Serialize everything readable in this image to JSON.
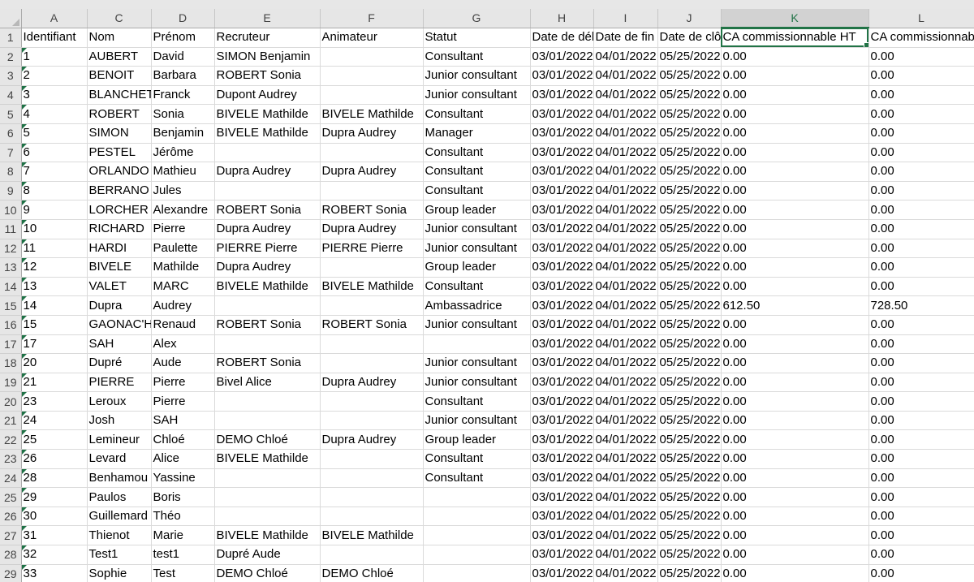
{
  "columns": [
    "A",
    "C",
    "D",
    "E",
    "F",
    "G",
    "H",
    "I",
    "J",
    "K",
    "L"
  ],
  "selected_column": "K",
  "header_row_number": "1",
  "headers": {
    "A": "Identifiant",
    "C": "Nom",
    "D": "Prénom",
    "E": "Recruteur",
    "F": "Animateur",
    "G": "Statut",
    "H": "Date de début",
    "I": "Date de fin",
    "J": "Date de clôture",
    "K": "CA commissionnable HT",
    "L": "CA commissionnable TTC"
  },
  "rows": [
    {
      "row": "2",
      "A": "1",
      "C": "AUBERT",
      "D": "David",
      "E": "SIMON Benjamin",
      "F": "",
      "G": "Consultant",
      "H": "03/01/2022",
      "I": "04/01/2022",
      "J": "05/25/2022",
      "K": "0.00",
      "L": "0.00"
    },
    {
      "row": "3",
      "A": "2",
      "C": "BENOIT",
      "D": "Barbara",
      "E": "ROBERT Sonia",
      "F": "",
      "G": "Junior consultant",
      "H": "03/01/2022",
      "I": "04/01/2022",
      "J": "05/25/2022",
      "K": "0.00",
      "L": "0.00"
    },
    {
      "row": "4",
      "A": "3",
      "C": "BLANCHET",
      "D": "Franck",
      "E": "Dupont Audrey",
      "F": "",
      "G": "Junior consultant",
      "H": "03/01/2022",
      "I": "04/01/2022",
      "J": "05/25/2022",
      "K": "0.00",
      "L": "0.00"
    },
    {
      "row": "5",
      "A": "4",
      "C": "ROBERT",
      "D": "Sonia",
      "E": "BIVELE Mathilde",
      "F": "BIVELE Mathilde",
      "G": "Consultant",
      "H": "03/01/2022",
      "I": "04/01/2022",
      "J": "05/25/2022",
      "K": "0.00",
      "L": "0.00"
    },
    {
      "row": "6",
      "A": "5",
      "C": "SIMON",
      "D": "Benjamin",
      "E": "BIVELE Mathilde",
      "F": "Dupra Audrey",
      "G": "Manager",
      "H": "03/01/2022",
      "I": "04/01/2022",
      "J": "05/25/2022",
      "K": "0.00",
      "L": "0.00"
    },
    {
      "row": "7",
      "A": "6",
      "C": "PESTEL",
      "D": "Jérôme",
      "E": "",
      "F": "",
      "G": "Consultant",
      "H": "03/01/2022",
      "I": "04/01/2022",
      "J": "05/25/2022",
      "K": "0.00",
      "L": "0.00"
    },
    {
      "row": "8",
      "A": "7",
      "C": "ORLANDO",
      "D": "Mathieu",
      "E": "Dupra Audrey",
      "F": "Dupra Audrey",
      "G": "Consultant",
      "H": "03/01/2022",
      "I": "04/01/2022",
      "J": "05/25/2022",
      "K": "0.00",
      "L": "0.00"
    },
    {
      "row": "9",
      "A": "8",
      "C": "BERRANO",
      "D": "Jules",
      "E": "",
      "F": "",
      "G": "Consultant",
      "H": "03/01/2022",
      "I": "04/01/2022",
      "J": "05/25/2022",
      "K": "0.00",
      "L": "0.00"
    },
    {
      "row": "10",
      "A": "9",
      "C": "LORCHER",
      "D": "Alexandre",
      "E": "ROBERT Sonia",
      "F": "ROBERT Sonia",
      "G": "Group leader",
      "H": "03/01/2022",
      "I": "04/01/2022",
      "J": "05/25/2022",
      "K": "0.00",
      "L": "0.00"
    },
    {
      "row": "11",
      "A": "10",
      "C": "RICHARD",
      "D": "Pierre",
      "E": "Dupra Audrey",
      "F": "Dupra Audrey",
      "G": "Junior consultant",
      "H": "03/01/2022",
      "I": "04/01/2022",
      "J": "05/25/2022",
      "K": "0.00",
      "L": "0.00"
    },
    {
      "row": "12",
      "A": "11",
      "C": "HARDI",
      "D": "Paulette",
      "E": "PIERRE Pierre",
      "F": "PIERRE Pierre",
      "G": "Junior consultant",
      "H": "03/01/2022",
      "I": "04/01/2022",
      "J": "05/25/2022",
      "K": "0.00",
      "L": "0.00"
    },
    {
      "row": "13",
      "A": "12",
      "C": "BIVELE",
      "D": "Mathilde",
      "E": "Dupra Audrey",
      "F": "",
      "G": "Group leader",
      "H": "03/01/2022",
      "I": "04/01/2022",
      "J": "05/25/2022",
      "K": "0.00",
      "L": "0.00"
    },
    {
      "row": "14",
      "A": "13",
      "C": "VALET",
      "D": "MARC",
      "E": "BIVELE Mathilde",
      "F": "BIVELE Mathilde",
      "G": "Consultant",
      "H": "03/01/2022",
      "I": "04/01/2022",
      "J": "05/25/2022",
      "K": "0.00",
      "L": "0.00"
    },
    {
      "row": "15",
      "A": "14",
      "C": "Dupra",
      "D": "Audrey",
      "E": "",
      "F": "",
      "G": "Ambassadrice",
      "H": "03/01/2022",
      "I": "04/01/2022",
      "J": "05/25/2022",
      "K": "612.50",
      "L": "728.50"
    },
    {
      "row": "16",
      "A": "15",
      "C": "GAONAC'H",
      "D": "Renaud",
      "E": "ROBERT Sonia",
      "F": "ROBERT Sonia",
      "G": "Junior consultant",
      "H": "03/01/2022",
      "I": "04/01/2022",
      "J": "05/25/2022",
      "K": "0.00",
      "L": "0.00"
    },
    {
      "row": "17",
      "A": "17",
      "C": "SAH",
      "D": "Alex",
      "E": "",
      "F": "",
      "G": "",
      "H": "03/01/2022",
      "I": "04/01/2022",
      "J": "05/25/2022",
      "K": "0.00",
      "L": "0.00"
    },
    {
      "row": "18",
      "A": "20",
      "C": "Dupré",
      "D": "Aude",
      "E": "ROBERT Sonia",
      "F": "",
      "G": "Junior consultant",
      "H": "03/01/2022",
      "I": "04/01/2022",
      "J": "05/25/2022",
      "K": "0.00",
      "L": "0.00"
    },
    {
      "row": "19",
      "A": "21",
      "C": "PIERRE",
      "D": "Pierre",
      "E": "Bivel Alice",
      "F": "Dupra Audrey",
      "G": "Junior consultant",
      "H": "03/01/2022",
      "I": "04/01/2022",
      "J": "05/25/2022",
      "K": "0.00",
      "L": "0.00"
    },
    {
      "row": "20",
      "A": "23",
      "C": "Leroux",
      "D": "Pierre",
      "E": "",
      "F": "",
      "G": "Consultant",
      "H": "03/01/2022",
      "I": "04/01/2022",
      "J": "05/25/2022",
      "K": "0.00",
      "L": "0.00"
    },
    {
      "row": "21",
      "A": "24",
      "C": "Josh",
      "D": "SAH",
      "E": "",
      "F": "",
      "G": "Junior consultant",
      "H": "03/01/2022",
      "I": "04/01/2022",
      "J": "05/25/2022",
      "K": "0.00",
      "L": "0.00"
    },
    {
      "row": "22",
      "A": "25",
      "C": "Lemineur",
      "D": "Chloé",
      "E": "DEMO Chloé",
      "F": "Dupra Audrey",
      "G": "Group leader",
      "H": "03/01/2022",
      "I": "04/01/2022",
      "J": "05/25/2022",
      "K": "0.00",
      "L": "0.00"
    },
    {
      "row": "23",
      "A": "26",
      "C": "Levard",
      "D": "Alice",
      "E": "BIVELE Mathilde",
      "F": "",
      "G": "Consultant",
      "H": "03/01/2022",
      "I": "04/01/2022",
      "J": "05/25/2022",
      "K": "0.00",
      "L": "0.00"
    },
    {
      "row": "24",
      "A": "28",
      "C": "Benhamou",
      "D": "Yassine",
      "E": "",
      "F": "",
      "G": "Consultant",
      "H": "03/01/2022",
      "I": "04/01/2022",
      "J": "05/25/2022",
      "K": "0.00",
      "L": "0.00"
    },
    {
      "row": "25",
      "A": "29",
      "C": "Paulos",
      "D": "Boris",
      "E": "",
      "F": "",
      "G": "",
      "H": "03/01/2022",
      "I": "04/01/2022",
      "J": "05/25/2022",
      "K": "0.00",
      "L": "0.00"
    },
    {
      "row": "26",
      "A": "30",
      "C": "Guillemard",
      "D": "Théo",
      "E": "",
      "F": "",
      "G": "",
      "H": "03/01/2022",
      "I": "04/01/2022",
      "J": "05/25/2022",
      "K": "0.00",
      "L": "0.00"
    },
    {
      "row": "27",
      "A": "31",
      "C": "Thienot",
      "D": "Marie",
      "E": "BIVELE Mathilde",
      "F": "BIVELE Mathilde",
      "G": "",
      "H": "03/01/2022",
      "I": "04/01/2022",
      "J": "05/25/2022",
      "K": "0.00",
      "L": "0.00"
    },
    {
      "row": "28",
      "A": "32",
      "C": "Test1",
      "D": "test1",
      "E": "Dupré Aude",
      "F": "",
      "G": "",
      "H": "03/01/2022",
      "I": "04/01/2022",
      "J": "05/25/2022",
      "K": "0.00",
      "L": "0.00"
    },
    {
      "row": "29",
      "A": "33",
      "C": "Sophie",
      "D": "Test",
      "E": "DEMO Chloé",
      "F": "DEMO Chloé",
      "G": "",
      "H": "03/01/2022",
      "I": "04/01/2022",
      "J": "05/25/2022",
      "K": "0.00",
      "L": "0.00"
    }
  ],
  "colors": {
    "accent": "#217346",
    "header_bg": "#e6e6e6",
    "gridline": "#dadada"
  }
}
